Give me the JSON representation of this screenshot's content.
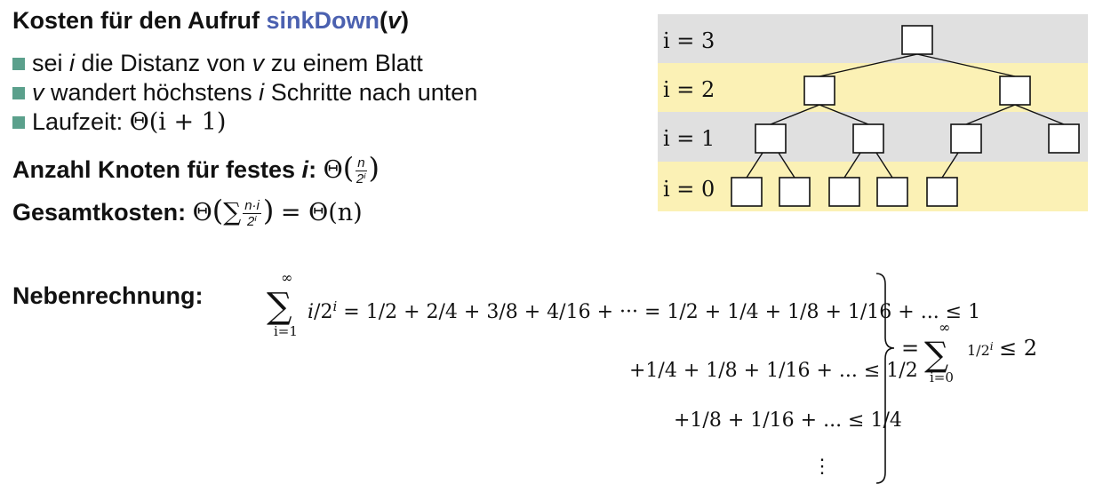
{
  "header": {
    "title_prefix": "Kosten für den Aufruf",
    "title_fn": "sinkDown",
    "title_arg_open": "(",
    "title_arg": "v",
    "title_arg_close": ")"
  },
  "bullets": [
    {
      "pre": "sei",
      "var1": "i",
      "mid": "die Distanz von",
      "var2": "v",
      "post": "zu einem Blatt"
    },
    {
      "var1": "v",
      "mid": "wandert höchstens",
      "var2": "i",
      "post": "Schritte nach unten"
    },
    {
      "pre": "Laufzeit:",
      "formula": "Θ(i + 1)"
    }
  ],
  "nodes_line": {
    "label": "Anzahl Knoten für festes",
    "var": "i",
    "colon": ":",
    "theta": "Θ",
    "num": "n",
    "den": "2ⁱ"
  },
  "total_line": {
    "label": "Gesamtkosten:",
    "theta": "Θ",
    "sum": "∑",
    "num": "n·i",
    "den": "2ⁱ",
    "result": "= Θ(n)"
  },
  "tree": {
    "levels": [
      "i = 3",
      "i = 2",
      "i = 1",
      "i = 0"
    ],
    "colors": {
      "gray": "#e0e0e0",
      "yellow": "#fbf1b5"
    }
  },
  "nebenrechnung": {
    "label": "Nebenrechnung:",
    "sum_upper": "∞",
    "sum_lower": "i=1",
    "rows": [
      "i/2ⁱ = 1/2 + 2/4 + 3/8 + 4/16 + ··· = 1/2 + 1/4 + 1/8 + 1/16 + ... ≤ 1",
      "+1/4 + 1/8 + 1/16 + ... ≤ 1/2",
      "+1/8 + 1/16 + ... ≤ 1/4",
      "⋮"
    ],
    "result_sum_upper": "∞",
    "result_sum_lower": "i=0",
    "result": "= ∑ 1/2ⁱ ≤ 2"
  }
}
